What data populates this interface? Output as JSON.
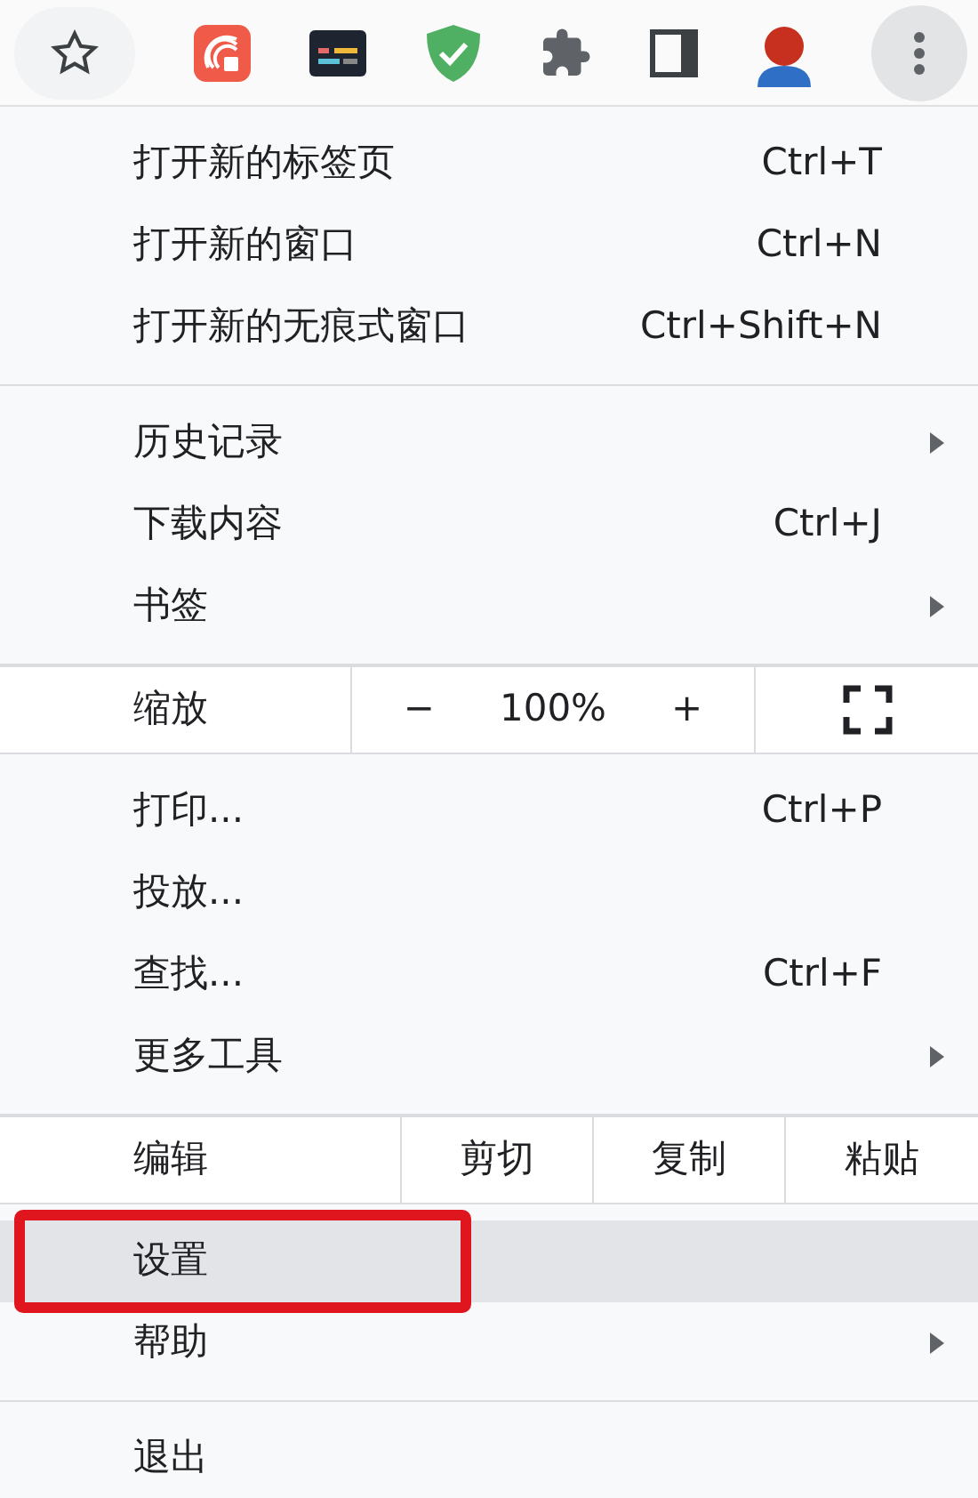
{
  "toolbar": {
    "menu_open": true
  },
  "menu": {
    "sections": [
      {
        "items": [
          {
            "kind": "item",
            "label": "打开新的标签页",
            "shortcut": "Ctrl+T",
            "submenu": false,
            "selected": false,
            "callout": false
          },
          {
            "kind": "item",
            "label": "打开新的窗口",
            "shortcut": "Ctrl+N",
            "submenu": false,
            "selected": false,
            "callout": false
          },
          {
            "kind": "item",
            "label": "打开新的无痕式窗口",
            "shortcut": "Ctrl+Shift+N",
            "submenu": false,
            "selected": false,
            "callout": false
          }
        ]
      },
      {
        "items": [
          {
            "kind": "item",
            "label": "历史记录",
            "submenu": true,
            "selected": false,
            "callout": false
          },
          {
            "kind": "item",
            "label": "下载内容",
            "shortcut": "Ctrl+J",
            "submenu": false,
            "selected": false,
            "callout": false
          },
          {
            "kind": "item",
            "label": "书签",
            "submenu": true,
            "selected": false,
            "callout": false
          }
        ]
      },
      {
        "items": [
          {
            "kind": "zoom",
            "label": "缩放",
            "minus": "−",
            "value": "100%",
            "plus": "+"
          }
        ]
      },
      {
        "items": [
          {
            "kind": "item",
            "label": "打印...",
            "shortcut": "Ctrl+P",
            "submenu": false,
            "selected": false,
            "callout": false
          },
          {
            "kind": "item",
            "label": "投放...",
            "submenu": false,
            "selected": false,
            "callout": false
          },
          {
            "kind": "item",
            "label": "查找...",
            "shortcut": "Ctrl+F",
            "submenu": false,
            "selected": false,
            "callout": false
          },
          {
            "kind": "item",
            "label": "更多工具",
            "submenu": true,
            "selected": false,
            "callout": false
          }
        ]
      },
      {
        "items": [
          {
            "kind": "edit",
            "label": "编辑",
            "actions": [
              "剪切",
              "复制",
              "粘贴"
            ]
          }
        ]
      },
      {
        "items": [
          {
            "kind": "item",
            "label": "设置",
            "submenu": false,
            "selected": true,
            "callout": true
          },
          {
            "kind": "item",
            "label": "帮助",
            "submenu": true,
            "selected": false,
            "callout": false
          }
        ]
      },
      {
        "items": [
          {
            "kind": "item",
            "label": "退出",
            "submenu": false,
            "selected": false,
            "callout": false
          }
        ]
      }
    ]
  }
}
